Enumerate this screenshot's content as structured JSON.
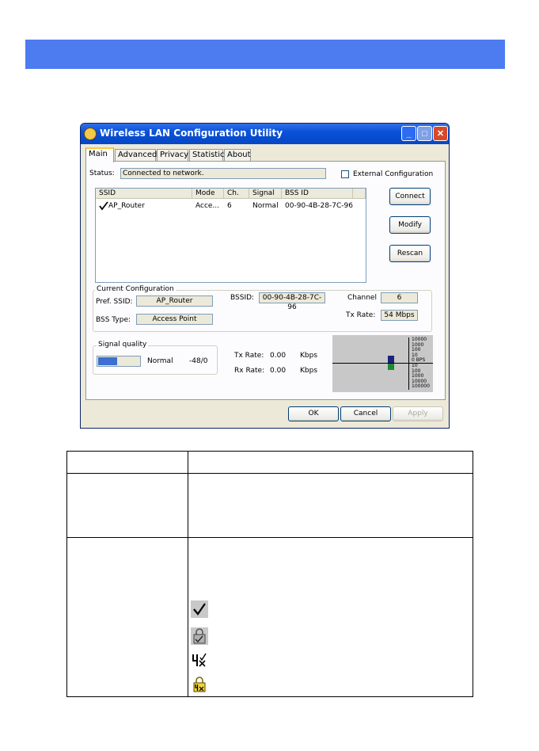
{
  "window": {
    "title": "Wireless LAN Configuration Utility",
    "controls": [
      "_",
      "□",
      "✕"
    ]
  },
  "tabs": [
    "Main",
    "Advanced",
    "Privacy",
    "Statistics",
    "About"
  ],
  "status": {
    "label": "Status:",
    "value": "Connected to network."
  },
  "external_config": {
    "label": "External Configuration",
    "checked": false
  },
  "network_list": {
    "columns": [
      "SSID",
      "Mode",
      "Ch.",
      "Signal",
      "BSS ID"
    ],
    "rows": [
      {
        "ssid": "AP_Router",
        "mode": "Acce...",
        "channel": "6",
        "signal": "Normal",
        "bssid": "00-90-4B-28-7C-96"
      }
    ]
  },
  "buttons": {
    "connect": "Connect",
    "modify": "Modify",
    "rescan": "Rescan",
    "ok": "OK",
    "cancel": "Cancel",
    "apply": "Apply"
  },
  "current_config": {
    "title": "Current Configuration",
    "pref_ssid_label": "Pref. SSID:",
    "pref_ssid": "AP_Router",
    "bss_type_label": "BSS Type:",
    "bss_type": "Access Point",
    "bssid_label": "BSSID:",
    "bssid": "00-90-4B-28-7C-96",
    "channel_label": "Channel",
    "channel": "6",
    "tx_rate_label": "Tx Rate:",
    "tx_rate": "54 Mbps"
  },
  "signal_quality": {
    "title": "Signal quality",
    "quality_text": "Normal",
    "dbm": "-48/0",
    "level": 0.45
  },
  "rates": {
    "tx_label": "Tx Rate:",
    "tx_value": "0.00",
    "tx_unit": "Kbps",
    "rx_label": "Rx Rate:",
    "rx_value": "0.00",
    "rx_unit": "Kbps"
  },
  "graph_scale": [
    "10000",
    "1000",
    "100",
    "10",
    "0 BPS",
    "10",
    "100",
    "1000",
    "10000",
    "100000"
  ],
  "colors": {
    "banner": "#4d7cf1",
    "titlebar": "#0a52d8",
    "tx_bar": "#1a237e",
    "rx_bar": "#1b8a2f",
    "signal_fill": "#3d6ed0"
  },
  "legend_icons": [
    "check-icon",
    "lock-icon",
    "no-signal-icon",
    "lock-no-signal-icon"
  ]
}
